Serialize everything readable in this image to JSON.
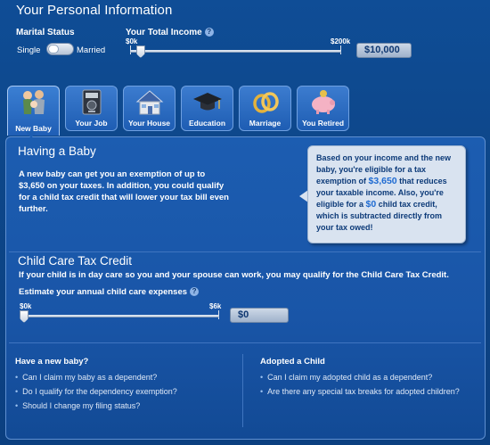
{
  "header": {
    "title": "Your Personal Information"
  },
  "marital_status": {
    "label": "Marital Status",
    "option_left": "Single",
    "option_right": "Married",
    "selected": "Single"
  },
  "income": {
    "label": "Your Total Income",
    "min_label": "$0k",
    "max_label": "$200k",
    "value": "$10,000",
    "slider_fraction": 0.05
  },
  "tabs": [
    {
      "label": "New Baby",
      "icon": "new-baby-icon",
      "active": true
    },
    {
      "label": "Your Job",
      "icon": "job-icon",
      "active": false
    },
    {
      "label": "Your House",
      "icon": "house-icon",
      "active": false
    },
    {
      "label": "Education",
      "icon": "graduation-cap-icon",
      "active": false
    },
    {
      "label": "Marriage",
      "icon": "wedding-rings-icon",
      "active": false
    },
    {
      "label": "You Retired",
      "icon": "piggy-bank-icon",
      "active": false
    }
  ],
  "baby": {
    "title": "Having a Baby",
    "text": "A new baby can get you an exemption of up to $3,650 on your taxes.  In addition, you could qualify for a child tax credit that will lower your tax bill even further."
  },
  "callout": {
    "part1": "Based on your income and the new baby, you're eligible for a tax exemption of ",
    "amount1": "$3,650",
    "part2": " that reduces your taxable income. Also, you're eligible for a ",
    "amount2": "$0",
    "part3": " child tax credit, which is subtracted directly from your tax owed!"
  },
  "childcare": {
    "title": "Child Care Tax Credit",
    "text": "If your child is in day care so you and your spouse can work, you may qualify for the Child Care Tax Credit.",
    "expense_label": "Estimate your annual child care expenses",
    "min_label": "$0k",
    "max_label": "$6k",
    "value": "$0",
    "slider_fraction": 0
  },
  "faq": {
    "left_title": "Have a new baby?",
    "left_items": [
      "Can I claim my baby as a dependent?",
      "Do I qualify for the dependency exemption?",
      "Should I change my filing status?"
    ],
    "right_title": "Adopted a Child",
    "right_items": [
      "Can I claim my adopted child as a dependent?",
      "Are there any special tax breaks for adopted children?"
    ]
  },
  "colors": {
    "background": "#0f4d96",
    "panel": "#1c5db1",
    "callout_bg": "#d9e3f0",
    "callout_text": "#0c3a78",
    "callout_amount": "#1f6bd2"
  }
}
